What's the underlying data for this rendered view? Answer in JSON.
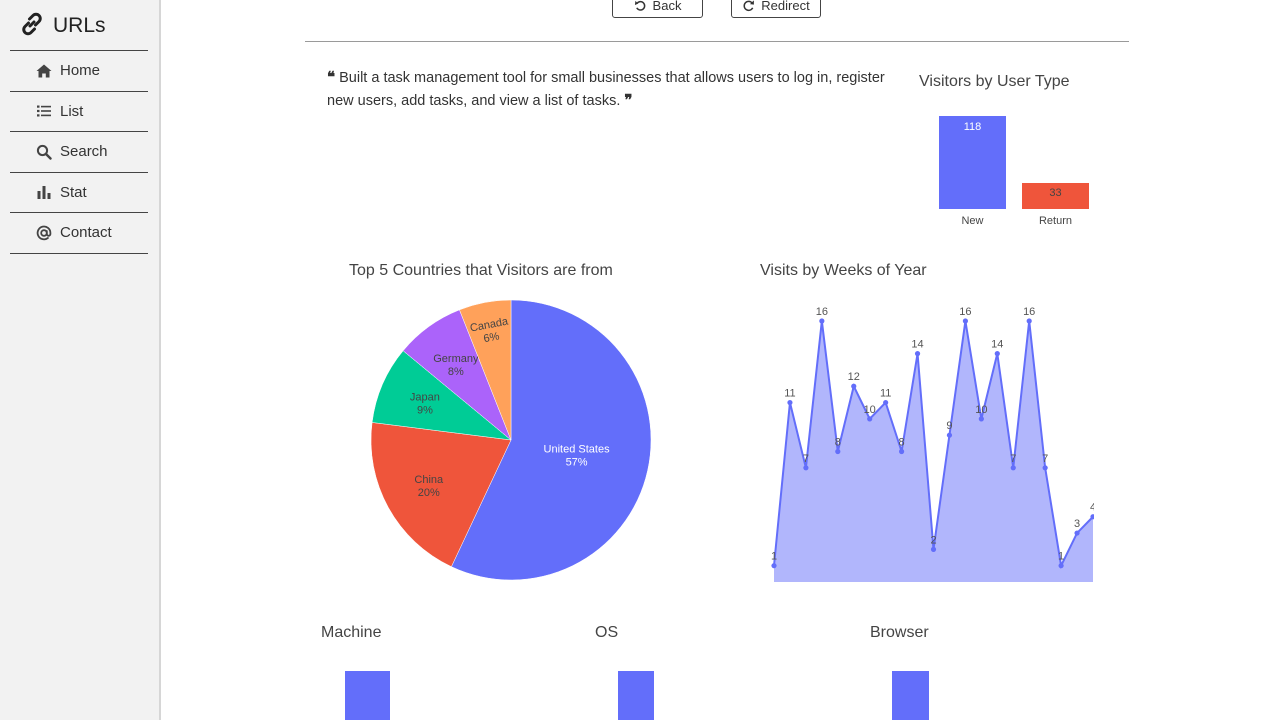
{
  "brand": {
    "title": "URLs"
  },
  "nav": {
    "items": [
      {
        "label": "Home",
        "icon": "home-icon"
      },
      {
        "label": "List",
        "icon": "list-icon"
      },
      {
        "label": "Search",
        "icon": "search-icon"
      },
      {
        "label": "Stat",
        "icon": "bar-chart-icon"
      },
      {
        "label": "Contact",
        "icon": "at-icon"
      }
    ]
  },
  "toolbar": {
    "back_label": "Back",
    "redirect_label": "Redirect"
  },
  "description": "Built a task management tool for small businesses that allows users to log in, register new users, add tasks, and view a list of tasks.",
  "colors": {
    "blue": "#636efa",
    "red": "#ef553b",
    "green": "#00cc96",
    "purple": "#ab63fa",
    "orange": "#ffa15a"
  },
  "chart_data": [
    {
      "type": "bar",
      "title": "Visitors by User Type",
      "categories": [
        "New",
        "Return"
      ],
      "values": [
        118,
        33
      ],
      "colors": [
        "#636efa",
        "#ef553b"
      ]
    },
    {
      "type": "pie",
      "title": "Top 5 Countries that Visitors are from",
      "labels": [
        "United States",
        "China",
        "Japan",
        "Germany",
        "Canada"
      ],
      "values": [
        57,
        20,
        9,
        8,
        6
      ],
      "text": [
        "57%",
        "20%",
        "9%",
        "8%",
        "6%"
      ],
      "colors": [
        "#636efa",
        "#ef553b",
        "#00cc96",
        "#ab63fa",
        "#ffa15a"
      ]
    },
    {
      "type": "area",
      "title": "Visits by Weeks of Year",
      "values": [
        1,
        11,
        7,
        16,
        8,
        12,
        10,
        11,
        8,
        14,
        2,
        9,
        16,
        10,
        14,
        7,
        16,
        7,
        1,
        3,
        4
      ],
      "ylim": [
        0,
        17
      ],
      "color": "#636efa"
    },
    {
      "type": "bar",
      "title": "Machine"
    },
    {
      "type": "bar",
      "title": "OS"
    },
    {
      "type": "bar",
      "title": "Browser"
    }
  ]
}
